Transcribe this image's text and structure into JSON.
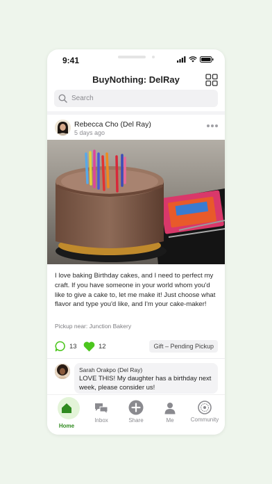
{
  "status_bar": {
    "time": "9:41"
  },
  "header": {
    "title": "BuyNothing: DelRay"
  },
  "search": {
    "placeholder": "Search"
  },
  "post": {
    "author": "Rebecca Cho (Del Ray)",
    "time": "5 days ago",
    "body": "I love baking Birthday cakes, and I need to perfect my craft. If you have someone in your world whom you'd like to give a cake to, let me make it! Just choose what flavor and type you'd like, and I'm your cake-maker!",
    "pickup": "Pickup near: Junction Bakery",
    "comment_count": "13",
    "like_count": "12",
    "status": "Gift – Pending Pickup"
  },
  "comment": {
    "author": "Sarah Orakpo (Del Ray)",
    "text": "LOVE THIS! My daughter has a birthday next week, please consider us!"
  },
  "tabs": [
    {
      "label": "Home",
      "icon": "home-icon"
    },
    {
      "label": "Inbox",
      "icon": "chat-icon"
    },
    {
      "label": "Share",
      "icon": "plus-icon"
    },
    {
      "label": "Me",
      "icon": "person-icon"
    },
    {
      "label": "Community",
      "icon": "community-icon"
    }
  ],
  "colors": {
    "accent": "#2f8a1f",
    "like": "#4cc61e",
    "background": "#eef5ec"
  }
}
